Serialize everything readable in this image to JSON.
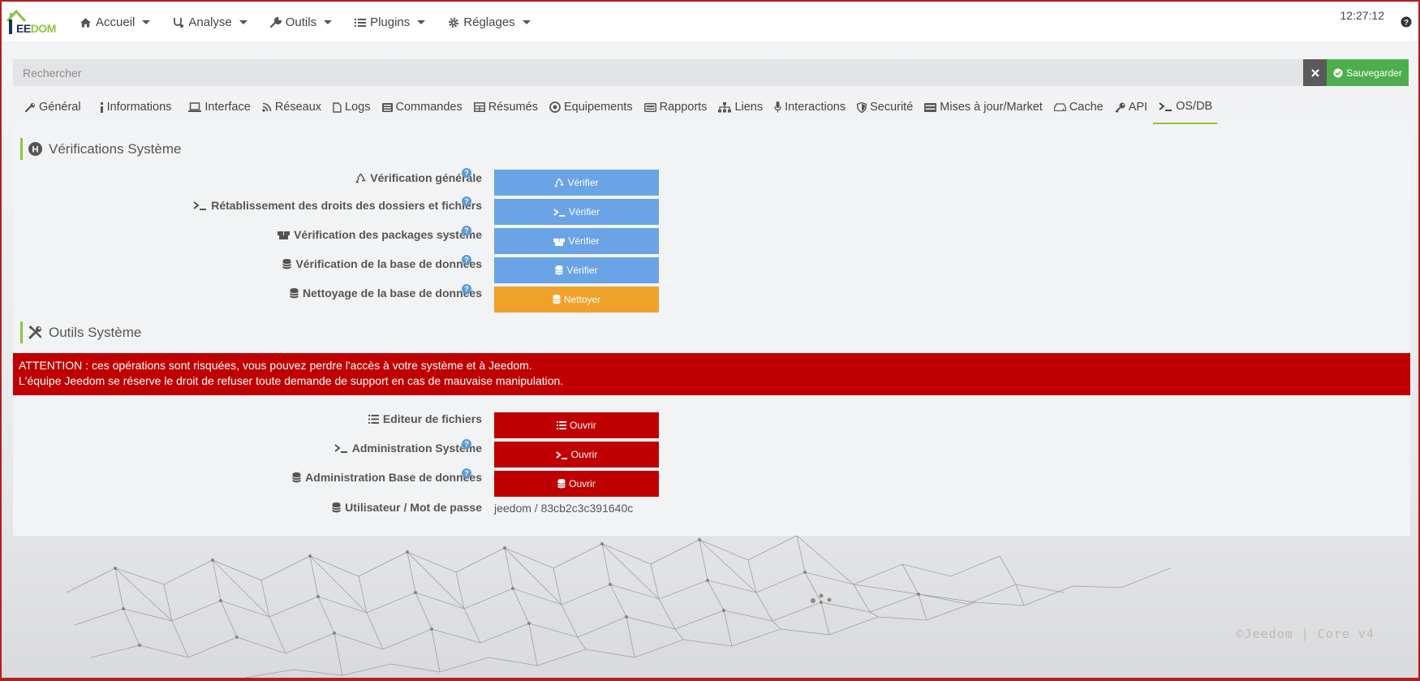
{
  "navbar": {
    "logo_text_main": "EE",
    "logo_text_accent": "DOM",
    "logo_prefix": "J",
    "menu": [
      {
        "label": "Accueil",
        "icon": "home-icon"
      },
      {
        "label": "Analyse",
        "icon": "stethoscope-icon"
      },
      {
        "label": "Outils",
        "icon": "wrench-icon"
      },
      {
        "label": "Plugins",
        "icon": "list-icon"
      },
      {
        "label": "Réglages",
        "icon": "gear-icon"
      }
    ],
    "clock": "12:27:12",
    "help": "?"
  },
  "search": {
    "placeholder": "Rechercher",
    "value": ""
  },
  "toolbar": {
    "save_label": "Sauvegarder"
  },
  "tabs": [
    {
      "label": "Général",
      "icon": "wrench-icon"
    },
    {
      "label": "Informations",
      "icon": "info-icon"
    },
    {
      "label": "Interface",
      "icon": "laptop-icon"
    },
    {
      "label": "Réseaux",
      "icon": "rss-icon"
    },
    {
      "label": "Logs",
      "icon": "file-icon"
    },
    {
      "label": "Commandes",
      "icon": "list-icon"
    },
    {
      "label": "Résumés",
      "icon": "table-icon"
    },
    {
      "label": "Equipements",
      "icon": "circle-arrows-icon"
    },
    {
      "label": "Rapports",
      "icon": "hdd-icon"
    },
    {
      "label": "Liens",
      "icon": "sitemap-icon"
    },
    {
      "label": "Interactions",
      "icon": "microphone-icon"
    },
    {
      "label": "Securité",
      "icon": "shield-icon"
    },
    {
      "label": "Mises à jour/Market",
      "icon": "server-icon"
    },
    {
      "label": "Cache",
      "icon": "drive-icon"
    },
    {
      "label": "API",
      "icon": "key-icon"
    },
    {
      "label": "OS/DB",
      "icon": "terminal-icon",
      "active": true
    }
  ],
  "verifications": {
    "title": "Vérifications Système",
    "rows": [
      {
        "label": "Vérification générale",
        "button": "Vérifier",
        "icon": "recycle-icon",
        "help": true,
        "color": "blue"
      },
      {
        "label": "Rétablissement des droits des dossiers et fichiers",
        "button": "Vérifier",
        "icon": "terminal-icon",
        "help": true,
        "color": "blue"
      },
      {
        "label": "Vérification des packages système",
        "button": "Vérifier",
        "icon": "boxes-icon",
        "help": true,
        "color": "blue"
      },
      {
        "label": "Vérification de la base de données",
        "button": "Vérifier",
        "icon": "database-icon",
        "help": true,
        "color": "blue"
      },
      {
        "label": "Nettoyage de la base de données",
        "button": "Nettoyer",
        "icon": "database-icon",
        "help": true,
        "color": "orange"
      }
    ]
  },
  "tools": {
    "title": "Outils Système",
    "warning_line1": "ATTENTION : ces opérations sont risquées, vous pouvez perdre l'accès à votre système et à Jeedom.",
    "warning_line2": "L'équipe Jeedom se réserve le droit de refuser toute demande de support en cas de mauvaise manipulation.",
    "rows": [
      {
        "label": "Editeur de fichiers",
        "button": "Ouvrir",
        "icon": "list-icon",
        "help": false
      },
      {
        "label": "Administration Système",
        "button": "Ouvrir",
        "icon": "terminal-icon",
        "help": true
      },
      {
        "label": "Administration Base de données",
        "button": "Ouvrir",
        "icon": "database-icon",
        "help": true
      }
    ],
    "credentials_label": "Utilisateur / Mot de passe",
    "credentials_value": "jeedom / 83cb2c3c391640c"
  },
  "footer": {
    "watermark": "©Jeedom | Core v4"
  },
  "colors": {
    "accent_green": "#8cc63f",
    "button_blue": "#6aa4e6",
    "button_orange": "#f0a12a",
    "danger_red": "#c00000",
    "save_green": "#4cae4c"
  }
}
